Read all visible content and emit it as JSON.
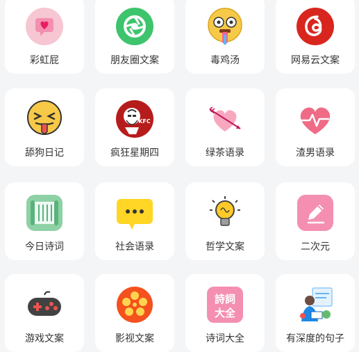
{
  "items": [
    {
      "label": "彩虹屁",
      "icon": "pink-heart-bubble-icon"
    },
    {
      "label": "朋友圈文案",
      "icon": "green-camera-aperture-icon"
    },
    {
      "label": "毒鸡汤",
      "icon": "crazy-emoji-icon"
    },
    {
      "label": "网易云文案",
      "icon": "netease-music-icon"
    },
    {
      "label": "舔狗日记",
      "icon": "tongue-out-emoji-icon"
    },
    {
      "label": "疯狂星期四",
      "icon": "kfc-logo-icon"
    },
    {
      "label": "绿茶语录",
      "icon": "heart-arrow-icon"
    },
    {
      "label": "渣男语录",
      "icon": "heart-pulse-icon"
    },
    {
      "label": "今日诗词",
      "icon": "green-scroll-icon"
    },
    {
      "label": "社会语录",
      "icon": "yellow-chat-bubble-icon"
    },
    {
      "label": "哲学文案",
      "icon": "lightbulb-icon"
    },
    {
      "label": "二次元",
      "icon": "pencil-icon"
    },
    {
      "label": "游戏文案",
      "icon": "gamepad-icon"
    },
    {
      "label": "影视文案",
      "icon": "film-reel-icon"
    },
    {
      "label": "诗词大全",
      "icon": "poem-stamp-icon"
    },
    {
      "label": "有深度的句子",
      "icon": "person-reading-icon"
    }
  ],
  "poem_stamp_text": [
    "詩詞",
    "大全"
  ],
  "kfc_stamp_text": "KFC"
}
